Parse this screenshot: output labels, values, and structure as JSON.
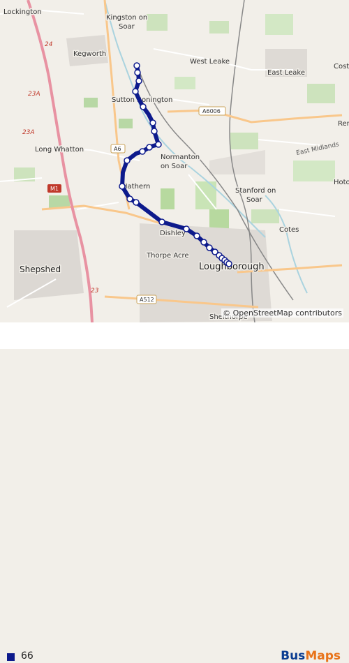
{
  "map": {
    "places": [
      {
        "name": "Lockington",
        "cls": "lbl"
      },
      {
        "name": "Kingston on",
        "cls": "lbl"
      },
      {
        "name": "Soar",
        "cls": "lbl"
      },
      {
        "name": "Kegworth",
        "cls": "lbl"
      },
      {
        "name": "West Leake",
        "cls": "lbl"
      },
      {
        "name": "East Leake",
        "cls": "lbl"
      },
      {
        "name": "Cost",
        "cls": "lbl"
      },
      {
        "name": "Sutton Bonington",
        "cls": "lbl"
      },
      {
        "name": "Long Whatton",
        "cls": "lbl"
      },
      {
        "name": "Normanton",
        "cls": "lbl"
      },
      {
        "name": "on Soar",
        "cls": "lbl"
      },
      {
        "name": "East Midlands",
        "cls": "lbl small"
      },
      {
        "name": "Rem",
        "cls": "lbl"
      },
      {
        "name": "Hathern",
        "cls": "lbl"
      },
      {
        "name": "Stanford on",
        "cls": "lbl"
      },
      {
        "name": "Soar",
        "cls": "lbl"
      },
      {
        "name": "Hoto",
        "cls": "lbl"
      },
      {
        "name": "Cotes",
        "cls": "lbl"
      },
      {
        "name": "Dishley",
        "cls": "lbl"
      },
      {
        "name": "Shepshed",
        "cls": "lbl mid"
      },
      {
        "name": "Thorpe Acre",
        "cls": "lbl"
      },
      {
        "name": "Loughborough",
        "cls": "lbl big"
      },
      {
        "name": "Shelthorpe",
        "cls": "lbl"
      }
    ],
    "road_labels": [
      "24",
      "23A",
      "23A",
      "M1",
      "A6",
      "A6006",
      "23",
      "A512"
    ],
    "route": {
      "name": "66",
      "color": "#0d1a8c"
    },
    "attribution": "© OpenStreetMap contributors"
  },
  "legend": {
    "route_label": "66",
    "color": "#0d1a8c"
  },
  "brand": {
    "part1": "Bus",
    "part2": "Maps"
  }
}
